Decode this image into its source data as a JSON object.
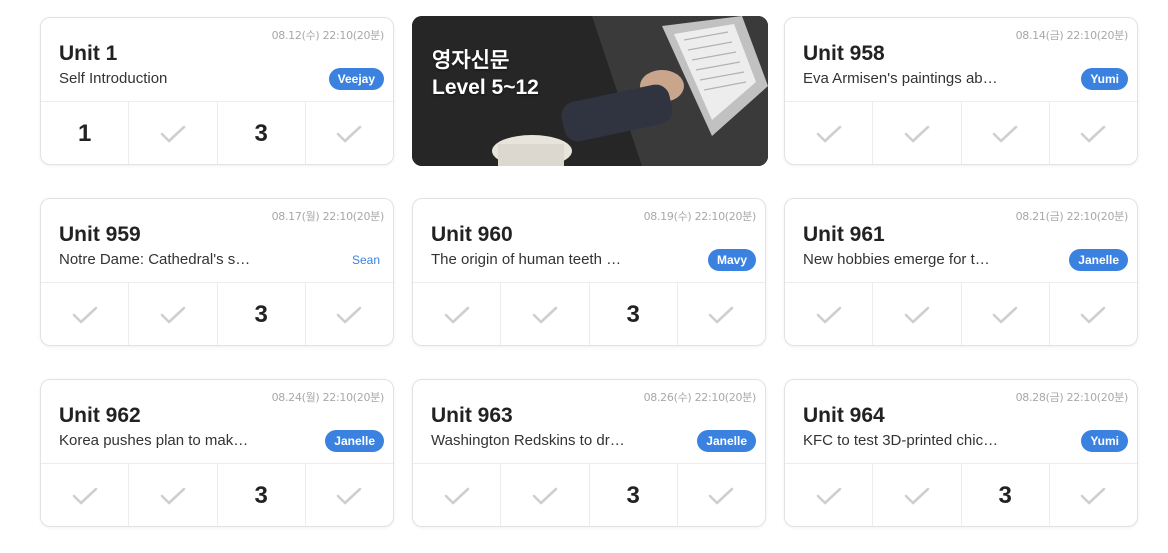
{
  "banner": {
    "title": "영자신문",
    "subtitle": "Level 5~12"
  },
  "cards": [
    {
      "date": "08.12(수) 22:10(20분)",
      "title": "Unit 1",
      "subtitle": "Self Introduction",
      "tutor": "Veejay",
      "cells": [
        "1",
        "check",
        "3",
        "check"
      ]
    },
    {
      "date": "08.14(금) 22:10(20분)",
      "title": "Unit 958",
      "subtitle": "Eva Armisen's paintings ab…",
      "tutor": "Yumi",
      "cells": [
        "check",
        "check",
        "check",
        "check"
      ]
    },
    {
      "date": "08.17(월) 22:10(20분)",
      "title": "Unit 959",
      "subtitle": "Notre Dame: Cathedral's s…",
      "tutor": "Sean",
      "cells": [
        "check",
        "check",
        "3",
        "check"
      ]
    },
    {
      "date": "08.19(수) 22:10(20분)",
      "title": "Unit 960",
      "subtitle": "The origin of human teeth …",
      "tutor": "Mavy",
      "cells": [
        "check",
        "check",
        "3",
        "check"
      ]
    },
    {
      "date": "08.21(금) 22:10(20분)",
      "title": "Unit 961",
      "subtitle": "New hobbies emerge for t…",
      "tutor": "Janelle",
      "cells": [
        "check",
        "check",
        "check",
        "check"
      ]
    },
    {
      "date": "08.24(월) 22:10(20분)",
      "title": "Unit 962",
      "subtitle": "Korea pushes plan to mak…",
      "tutor": "Janelle",
      "cells": [
        "check",
        "check",
        "3",
        "check"
      ]
    },
    {
      "date": "08.26(수) 22:10(20분)",
      "title": "Unit 963",
      "subtitle": "Washington Redskins to dr…",
      "tutor": "Janelle",
      "cells": [
        "check",
        "check",
        "3",
        "check"
      ]
    },
    {
      "date": "08.28(금) 22:10(20분)",
      "title": "Unit 964",
      "subtitle": "KFC to test 3D-printed chic…",
      "tutor": "Yumi",
      "cells": [
        "check",
        "check",
        "3",
        "check"
      ]
    }
  ],
  "colors": {
    "badge": "#3b82e0",
    "check": "#cfcfcf"
  },
  "icons": {
    "check": "check-icon"
  }
}
